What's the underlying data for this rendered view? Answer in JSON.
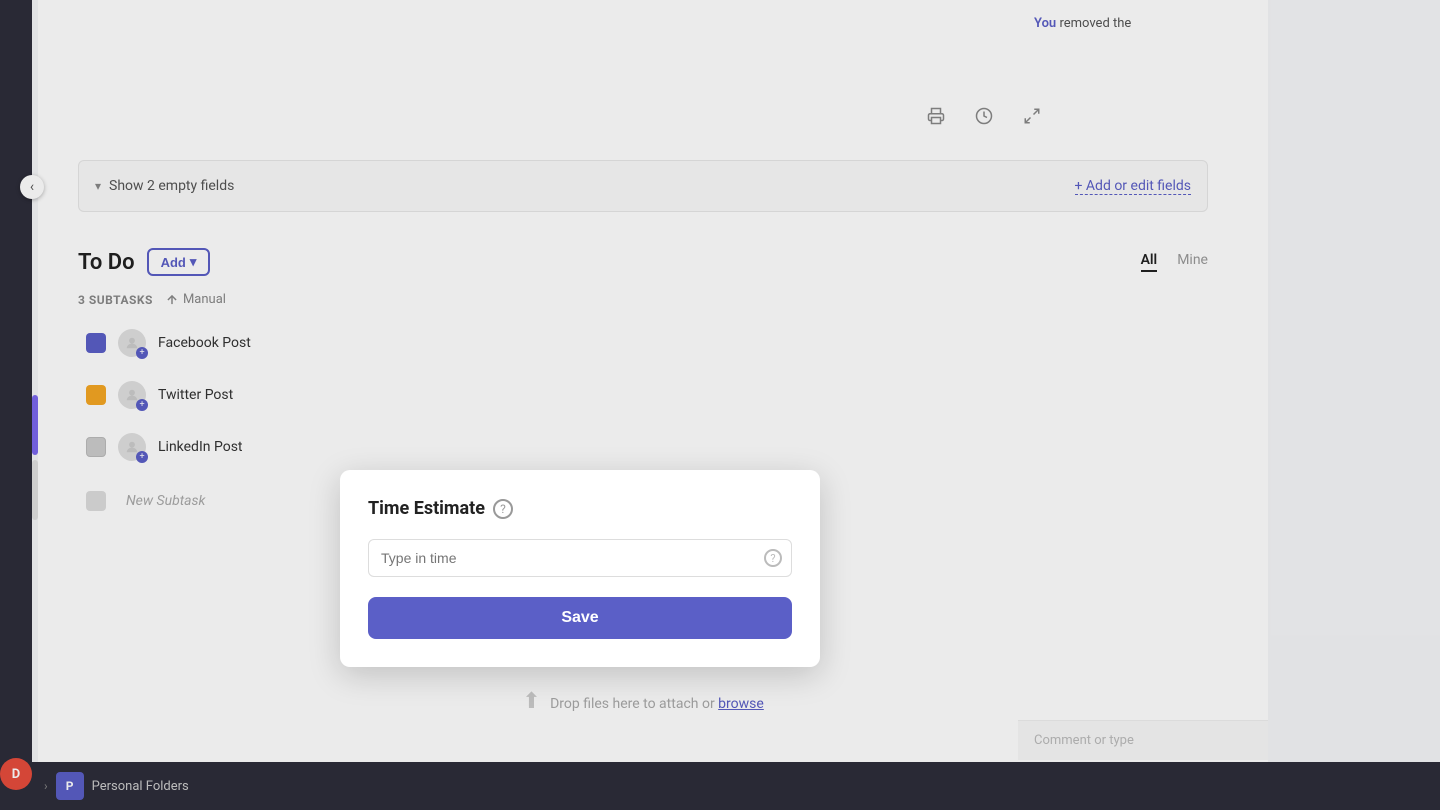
{
  "sidebar": {
    "avatar_initial": "D",
    "chevron": "‹"
  },
  "notification": {
    "prefix": "You",
    "text": " removed the"
  },
  "toolbar": {
    "print_icon": "🖨",
    "history_icon": "🕐",
    "expand_icon": "⤢"
  },
  "show_empty": {
    "label": "Show 2 empty fields",
    "add_label": "+ Add or edit fields"
  },
  "todo": {
    "title": "To Do",
    "add_label": "Add",
    "tabs": {
      "all": "All",
      "mine": "Mine"
    },
    "subtasks_header": "3 SUBTASKS",
    "sort_label": "Manual",
    "tasks": [
      {
        "name": "Facebook Post",
        "color": "blue"
      },
      {
        "name": "Twitter Post",
        "color": "yellow"
      },
      {
        "name": "LinkedIn Post",
        "color": "gray"
      }
    ],
    "new_subtask_placeholder": "New Subtask"
  },
  "modal": {
    "title": "Time Estimate",
    "input_placeholder": "Type in time",
    "save_label": "Save"
  },
  "drop_files": {
    "text": "Drop files here to attach or ",
    "browse_label": "browse"
  },
  "comment_bar": {
    "placeholder": "Comment or type"
  },
  "bottom_bar": {
    "folder_initial": "P",
    "folder_name": "Personal Folders",
    "chevron": "›"
  }
}
